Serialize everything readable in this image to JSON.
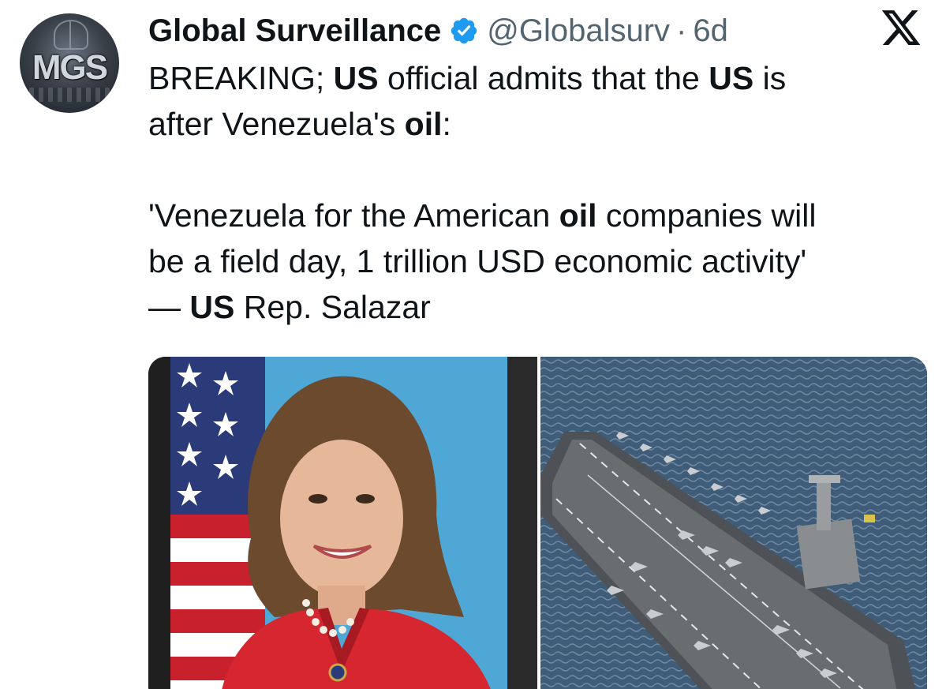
{
  "tweet": {
    "display_name": "Global Surveillance",
    "handle": "@Globalsurv",
    "separator": "·",
    "time": "6d",
    "avatar_text": "MGS",
    "verified_icon": "verified-badge-icon",
    "platform_icon": "x-logo-icon",
    "text": {
      "line1_a": "BREAKING; ",
      "line1_b": "US",
      "line1_c": " official admits that the ",
      "line1_d": "US",
      "line1_e": " is",
      "line2_a": "after Venezuela's ",
      "line2_b": "oil",
      "line2_c": ":",
      "quote1_a": "'Venezuela for the American ",
      "quote1_b": "oil",
      "quote1_c": " companies will",
      "quote2": "be a field day, 1 trillion USD economic activity'",
      "quote3_a": "— ",
      "quote3_b": "US",
      "quote3_c": " Rep. Salazar"
    },
    "media": [
      {
        "name": "portrait-photo"
      },
      {
        "name": "aircraft-carrier-photo"
      }
    ],
    "colors": {
      "verified_blue": "#1d9bf0",
      "secondary_text": "#536471",
      "primary_text": "#0f1419"
    }
  }
}
